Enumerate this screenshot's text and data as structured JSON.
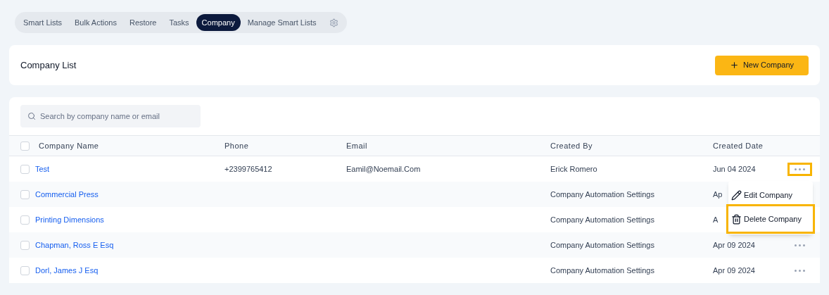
{
  "tabs": [
    {
      "label": "Smart Lists",
      "selected": false
    },
    {
      "label": "Bulk Actions",
      "selected": false
    },
    {
      "label": "Restore",
      "selected": false
    },
    {
      "label": "Tasks",
      "selected": false
    },
    {
      "label": "Company",
      "selected": true
    },
    {
      "label": "Manage Smart Lists",
      "selected": false
    }
  ],
  "header": {
    "title": "Company List",
    "button": "New Company"
  },
  "search": {
    "placeholder": "Search by company name or email"
  },
  "table": {
    "select_all_checked": false,
    "columns": [
      "Company Name",
      "Phone",
      "Email",
      "Created By",
      "Created Date"
    ],
    "rows": [
      {
        "checked": false,
        "name": "Test",
        "phone": "+2399765412",
        "email": "Eamil@Noemail.Com",
        "created_by": "Erick Romero",
        "date": "Jun 04 2024"
      },
      {
        "checked": false,
        "name": "Commercial Press",
        "created_by": "Company Automation Settings",
        "date": "Ap"
      },
      {
        "checked": false,
        "name": "Printing Dimensions",
        "created_by": "Company Automation Settings",
        "date": "A"
      },
      {
        "checked": false,
        "name": "Chapman, Ross E Esq",
        "created_by": "Company Automation Settings",
        "date": "Apr 09 2024"
      },
      {
        "checked": false,
        "name": "Dorl, James J Esq",
        "created_by": "Company Automation Settings",
        "date": "Apr 09 2024"
      }
    ]
  },
  "menu": {
    "open": true,
    "items": [
      {
        "kind": "edit",
        "label": "Edit Company",
        "highlighted": false
      },
      {
        "kind": "delete",
        "label": "Delete Company",
        "highlighted": true
      }
    ]
  }
}
